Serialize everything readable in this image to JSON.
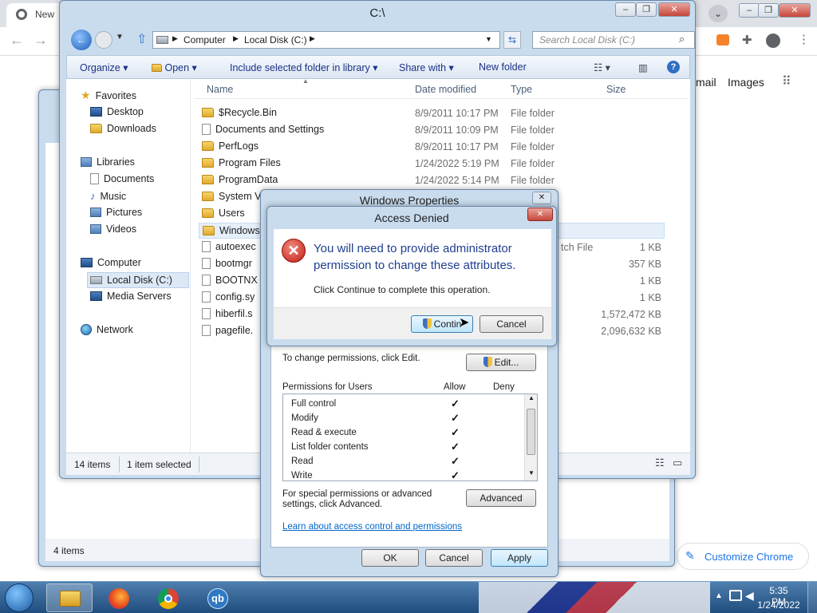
{
  "chrome": {
    "tab_title": "New",
    "links": [
      "mail",
      "Images"
    ],
    "customize": "Customize Chrome"
  },
  "explorer": {
    "title": "C:\\",
    "address": [
      "Computer",
      "Local Disk (C:)"
    ],
    "search_placeholder": "Search Local Disk (C:)",
    "toolbar": {
      "organize": "Organize",
      "open": "Open",
      "include": "Include selected folder in library",
      "share": "Share with",
      "new_folder": "New folder"
    },
    "nav": {
      "favorites": "Favorites",
      "desktop": "Desktop",
      "downloads": "Downloads",
      "libraries": "Libraries",
      "documents": "Documents",
      "music": "Music",
      "pictures": "Pictures",
      "videos": "Videos",
      "computer": "Computer",
      "local_disk": "Local Disk (C:)",
      "media_servers": "Media Servers",
      "network": "Network"
    },
    "columns": {
      "name": "Name",
      "date": "Date modified",
      "type": "Type",
      "size": "Size"
    },
    "files": [
      {
        "name": "$Recycle.Bin",
        "date": "8/9/2011 10:17 PM",
        "type": "File folder",
        "size": ""
      },
      {
        "name": "Documents and Settings",
        "date": "8/9/2011 10:09 PM",
        "type": "File folder",
        "size": ""
      },
      {
        "name": "PerfLogs",
        "date": "8/9/2011 10:17 PM",
        "type": "File folder",
        "size": ""
      },
      {
        "name": "Program Files",
        "date": "1/24/2022 5:19 PM",
        "type": "File folder",
        "size": ""
      },
      {
        "name": "ProgramData",
        "date": "1/24/2022 5:14 PM",
        "type": "File folder",
        "size": ""
      },
      {
        "name": "System V",
        "date": "",
        "type": "",
        "size": ""
      },
      {
        "name": "Users",
        "date": "",
        "type": "",
        "size": ""
      },
      {
        "name": "Windows",
        "date": "",
        "type": "",
        "size": ""
      },
      {
        "name": "autoexec",
        "date": "",
        "type": "tch File",
        "size": "1 KB"
      },
      {
        "name": "bootmgr",
        "date": "",
        "type": "",
        "size": "357 KB"
      },
      {
        "name": "BOOTNX",
        "date": "",
        "type": "",
        "size": "1 KB"
      },
      {
        "name": "config.sy",
        "date": "",
        "type": "",
        "size": "1 KB"
      },
      {
        "name": "hiberfil.s",
        "date": "",
        "type": "",
        "size": "1,572,472 KB"
      },
      {
        "name": "pagefile.",
        "date": "",
        "type": "",
        "size": "2,096,632 KB"
      }
    ],
    "status_items": "14 items",
    "status_selected": "1 item selected"
  },
  "back_explorer": {
    "status": "4 items"
  },
  "properties": {
    "title": "Windows Properties",
    "change_text": "To change permissions, click Edit.",
    "edit_button": "Edit...",
    "permissions_for": "Permissions for Users",
    "allow": "Allow",
    "deny": "Deny",
    "permissions": [
      "Full control",
      "Modify",
      "Read & execute",
      "List folder contents",
      "Read",
      "Write"
    ],
    "special_text": "For special permissions or advanced settings, click Advanced.",
    "advanced_button": "Advanced",
    "learn_link": "Learn about access control and permissions",
    "ok": "OK",
    "cancel": "Cancel",
    "apply": "Apply"
  },
  "denied": {
    "title": "Access Denied",
    "heading": "You will need to provide administrator permission to change these attributes.",
    "body": "Click Continue to complete this operation.",
    "continue": "Contin",
    "cancel": "Cancel"
  },
  "taskbar": {
    "time": "5:35 PM",
    "date": "1/24/2022",
    "qb": "qb"
  }
}
